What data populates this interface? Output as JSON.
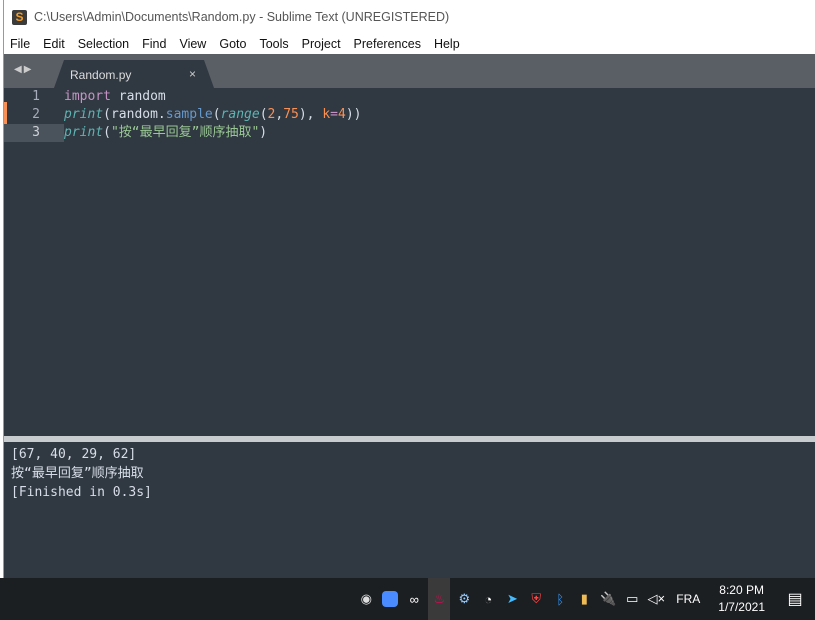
{
  "window": {
    "title": "C:\\Users\\Admin\\Documents\\Random.py - Sublime Text (UNREGISTERED)"
  },
  "menu": [
    "File",
    "Edit",
    "Selection",
    "Find",
    "View",
    "Goto",
    "Tools",
    "Project",
    "Preferences",
    "Help"
  ],
  "tab": {
    "label": "Random.py",
    "close": "×"
  },
  "editor": {
    "line_numbers": [
      "1",
      "2",
      "3"
    ],
    "line1": {
      "kw": "import",
      "rest": " random"
    },
    "line2": {
      "fn": "print",
      "p1": "(random.",
      "meth": "sample",
      "p2": "(",
      "fn2": "range",
      "p3": "(",
      "n1": "2",
      "c": ",",
      "n2": "75",
      "p4": "), ",
      "k": "k",
      "eq": "=",
      "n3": "4",
      "p5": "))"
    },
    "line3": {
      "fn": "print",
      "p1": "(",
      "str": "\"按“最早回复”顺序抽取\"",
      "p2": ")"
    }
  },
  "output": {
    "lines": [
      "[67, 40, 29, 62]",
      "按“最早回复”顺序抽取",
      "[Finished in 0.3s]"
    ]
  },
  "taskbar": {
    "language": "FRA",
    "time": "8:20 PM",
    "date": "1/7/2021"
  }
}
